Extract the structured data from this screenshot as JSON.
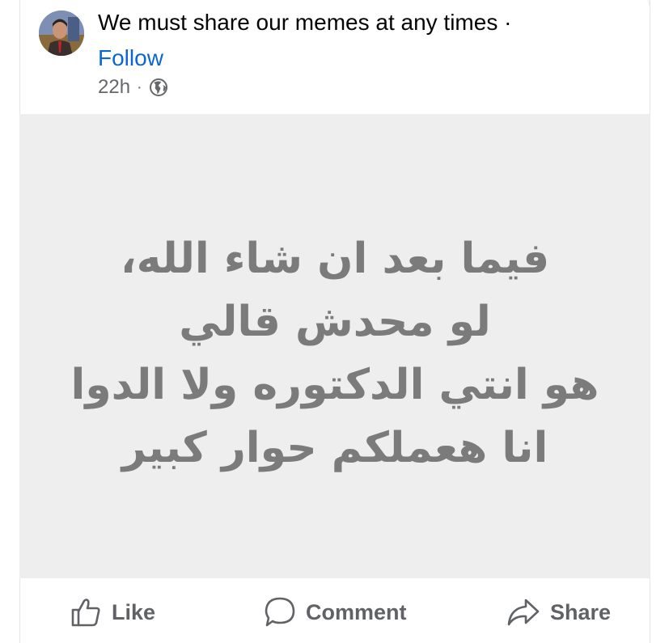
{
  "post": {
    "title": "We must share our memes at any times ·",
    "follow_label": "Follow",
    "time": "22h",
    "separator": "·",
    "visibility_icon": "globe-icon"
  },
  "meme": {
    "lines": [
      "فيما بعد ان شاء الله،",
      "لو محدش قالي",
      "هو انتي الدكتوره ولا الدوا",
      "انا هعملكم حوار كبير"
    ],
    "background_color": "#eeeeee",
    "text_color": "#7b7b7b"
  },
  "actions": {
    "like_label": "Like",
    "comment_label": "Comment",
    "share_label": "Share"
  },
  "colors": {
    "follow": "#0a66d0",
    "meta": "#65676b",
    "action": "#606266"
  }
}
